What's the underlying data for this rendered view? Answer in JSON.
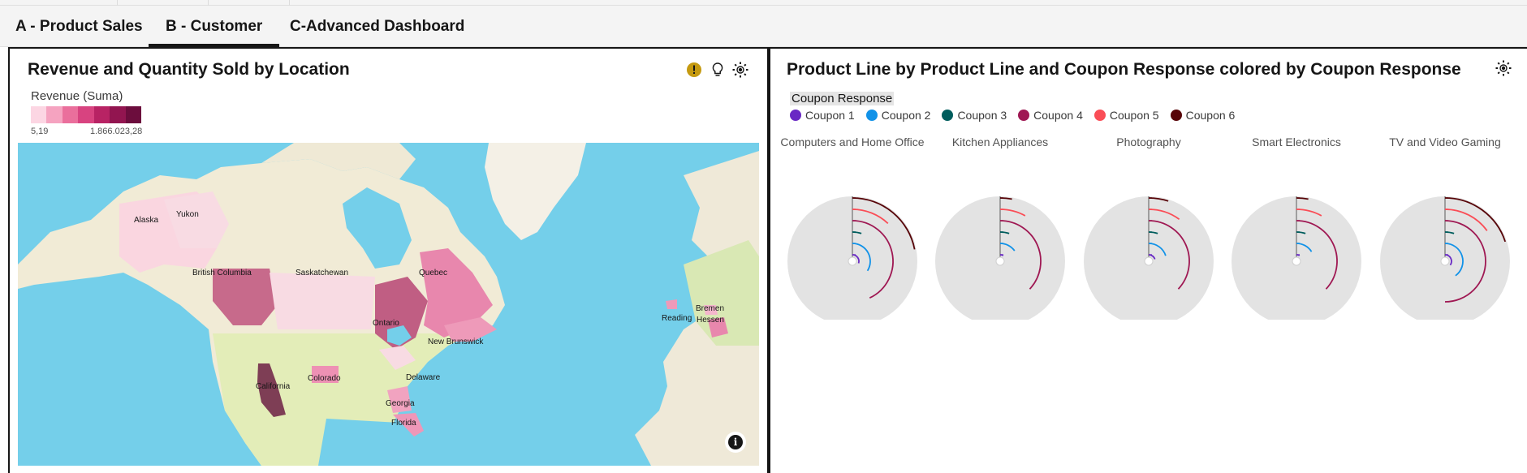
{
  "tabs": [
    {
      "label": "A - Product Sales",
      "active": false
    },
    {
      "label": "B - Customer",
      "active": true
    },
    {
      "label": "C-Advanced Dashboard",
      "active": false
    }
  ],
  "left_panel": {
    "title": "Revenue and Quantity Sold by Location",
    "icons": [
      "warning-icon",
      "lightbulb-icon",
      "settings-icon"
    ],
    "legend": {
      "title": "Revenue (Suma)",
      "min": "5,19",
      "max": "1.866.023,28",
      "colors": [
        "#fcd6e3",
        "#f5a3c0",
        "#ea6f9c",
        "#d84380",
        "#b82364",
        "#921550",
        "#6c0d3d"
      ]
    },
    "map_labels": [
      "Alaska",
      "Yukon",
      "British Columbia",
      "Saskatchewan",
      "Ontario",
      "Quebec",
      "New Brunswick",
      "Colorado",
      "California",
      "Delaware",
      "Georgia",
      "Florida",
      "Reading",
      "Bremen",
      "Hessen"
    ],
    "info_label": "i"
  },
  "right_panel": {
    "title": "Product Line by Product Line and Coupon Response colored by Coupon Response",
    "legend_title": "Coupon Response",
    "coupons": [
      {
        "label": "Coupon 1",
        "color": "#6929c4"
      },
      {
        "label": "Coupon 2",
        "color": "#1192e8"
      },
      {
        "label": "Coupon 3",
        "color": "#005d5d"
      },
      {
        "label": "Coupon 4",
        "color": "#9f1853"
      },
      {
        "label": "Coupon 5",
        "color": "#fa4d56"
      },
      {
        "label": "Coupon 6",
        "color": "#570408"
      }
    ],
    "product_lines": [
      "Computers and Home Office",
      "Kitchen Appliances",
      "Photography",
      "Smart Electronics",
      "TV and Video Gaming"
    ]
  },
  "chart_data": {
    "type": "radial-bar",
    "categories": [
      "Computers and Home Office",
      "Kitchen Appliances",
      "Photography",
      "Smart Electronics",
      "TV and Video Gaming"
    ],
    "series_names": [
      "Coupon 1",
      "Coupon 2",
      "Coupon 3",
      "Coupon 4",
      "Coupon 5",
      "Coupon 6"
    ],
    "values": [
      [
        0.3,
        0.34,
        0.05,
        0.43,
        0.12,
        0.22
      ],
      [
        0.08,
        0.15,
        0.05,
        0.37,
        0.08,
        0.03
      ],
      [
        0.2,
        0.2,
        0.05,
        0.37,
        0.1,
        0.05
      ],
      [
        0.08,
        0.16,
        0.05,
        0.37,
        0.08,
        0.03
      ],
      [
        0.35,
        0.4,
        0.05,
        0.5,
        0.15,
        0.2
      ]
    ]
  }
}
